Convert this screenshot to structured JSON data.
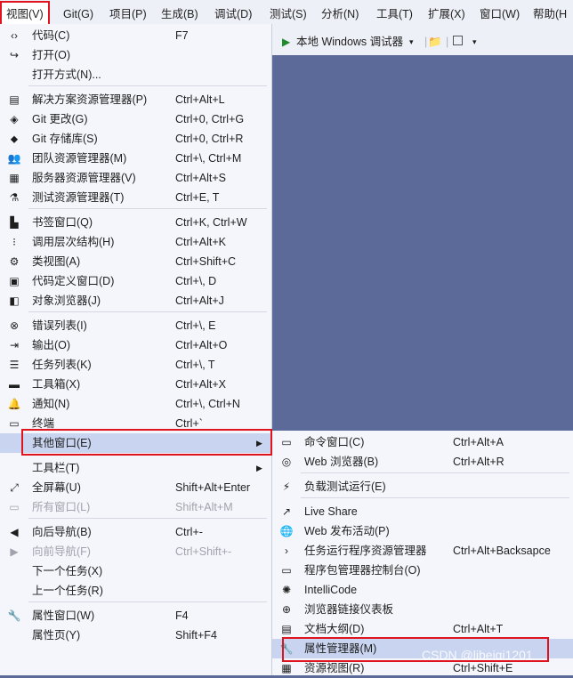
{
  "menubar": [
    {
      "label": "视图(V)",
      "active": true
    },
    {
      "label": "Git(G)"
    },
    {
      "label": "项目(P)"
    },
    {
      "label": "生成(B)"
    },
    {
      "label": "调试(D)"
    },
    {
      "label": "测试(S)"
    },
    {
      "label": "分析(N)"
    },
    {
      "label": "工具(T)"
    },
    {
      "label": "扩展(X)"
    },
    {
      "label": "窗口(W)"
    },
    {
      "label": "帮助(H"
    }
  ],
  "toolbar": {
    "run_label": "本地 Windows 调试器",
    "dropdown": "▾"
  },
  "menu": [
    {
      "label": "代码(C)",
      "shortcut": "F7",
      "icon": "code-icon"
    },
    {
      "label": "打开(O)",
      "shortcut": "",
      "icon": "open-icon"
    },
    {
      "label": "打开方式(N)...",
      "shortcut": "",
      "icon": ""
    },
    {
      "sep": true
    },
    {
      "label": "解决方案资源管理器(P)",
      "shortcut": "Ctrl+Alt+L",
      "icon": "solution-explorer-icon"
    },
    {
      "label": "Git 更改(G)",
      "shortcut": "Ctrl+0, Ctrl+G",
      "icon": "git-changes-icon"
    },
    {
      "label": "Git 存储库(S)",
      "shortcut": "Ctrl+0, Ctrl+R",
      "icon": "git-repository-icon"
    },
    {
      "label": "团队资源管理器(M)",
      "shortcut": "Ctrl+\\, Ctrl+M",
      "icon": "team-explorer-icon"
    },
    {
      "label": "服务器资源管理器(V)",
      "shortcut": "Ctrl+Alt+S",
      "icon": "server-explorer-icon"
    },
    {
      "label": "测试资源管理器(T)",
      "shortcut": "Ctrl+E, T",
      "icon": "test-explorer-icon"
    },
    {
      "sep": true
    },
    {
      "label": "书签窗口(Q)",
      "shortcut": "Ctrl+K, Ctrl+W",
      "icon": "bookmark-icon"
    },
    {
      "label": "调用层次结构(H)",
      "shortcut": "Ctrl+Alt+K",
      "icon": "call-hierarchy-icon"
    },
    {
      "label": "类视图(A)",
      "shortcut": "Ctrl+Shift+C",
      "icon": "class-view-icon"
    },
    {
      "label": "代码定义窗口(D)",
      "shortcut": "Ctrl+\\, D",
      "icon": "code-definition-icon"
    },
    {
      "label": "对象浏览器(J)",
      "shortcut": "Ctrl+Alt+J",
      "icon": "object-browser-icon"
    },
    {
      "sep": true
    },
    {
      "label": "错误列表(I)",
      "shortcut": "Ctrl+\\, E",
      "icon": "error-list-icon"
    },
    {
      "label": "输出(O)",
      "shortcut": "Ctrl+Alt+O",
      "icon": "output-icon"
    },
    {
      "label": "任务列表(K)",
      "shortcut": "Ctrl+\\, T",
      "icon": "task-list-icon"
    },
    {
      "label": "工具箱(X)",
      "shortcut": "Ctrl+Alt+X",
      "icon": "toolbox-icon"
    },
    {
      "label": "通知(N)",
      "shortcut": "Ctrl+\\, Ctrl+N",
      "icon": "notification-bell-icon"
    },
    {
      "label": "终端",
      "shortcut": "Ctrl+`",
      "icon": "terminal-icon"
    },
    {
      "label": "其他窗口(E)",
      "shortcut": "",
      "icon": "",
      "submenu": true,
      "highlight": true
    },
    {
      "sep": true
    },
    {
      "label": "工具栏(T)",
      "shortcut": "",
      "icon": "",
      "submenu": true
    },
    {
      "label": "全屏幕(U)",
      "shortcut": "Shift+Alt+Enter",
      "icon": "fullscreen-icon"
    },
    {
      "label": "所有窗口(L)",
      "shortcut": "Shift+Alt+M",
      "icon": "all-windows-icon",
      "disabled": true
    },
    {
      "sep": true
    },
    {
      "label": "向后导航(B)",
      "shortcut": "Ctrl+-",
      "icon": "navigate-back-icon"
    },
    {
      "label": "向前导航(F)",
      "shortcut": "Ctrl+Shift+-",
      "icon": "navigate-forward-icon",
      "disabled": true
    },
    {
      "label": "下一个任务(X)",
      "shortcut": "",
      "icon": ""
    },
    {
      "label": "上一个任务(R)",
      "shortcut": "",
      "icon": ""
    },
    {
      "sep": true
    },
    {
      "label": "属性窗口(W)",
      "shortcut": "F4",
      "icon": "wrench-icon"
    },
    {
      "label": "属性页(Y)",
      "shortcut": "Shift+F4",
      "icon": ""
    }
  ],
  "submenu": [
    {
      "label": "命令窗口(C)",
      "shortcut": "Ctrl+Alt+A",
      "icon": "command-window-icon"
    },
    {
      "label": "Web 浏览器(B)",
      "shortcut": "Ctrl+Alt+R",
      "icon": "web-browser-icon"
    },
    {
      "sep": true
    },
    {
      "label": "负载测试运行(E)",
      "shortcut": "",
      "icon": "load-test-icon"
    },
    {
      "sep": true
    },
    {
      "label": "Live Share",
      "shortcut": "",
      "icon": "live-share-icon"
    },
    {
      "label": "Web 发布活动(P)",
      "shortcut": "",
      "icon": "web-publish-icon"
    },
    {
      "label": "任务运行程序资源管理器",
      "shortcut": "Ctrl+Alt+Backsapce",
      "icon": "task-runner-icon"
    },
    {
      "label": "程序包管理器控制台(O)",
      "shortcut": "",
      "icon": "package-console-icon"
    },
    {
      "label": "IntelliCode",
      "shortcut": "",
      "icon": "intellicode-icon"
    },
    {
      "label": "浏览器链接仪表板",
      "shortcut": "",
      "icon": "browser-link-icon"
    },
    {
      "label": "文档大纲(D)",
      "shortcut": "Ctrl+Alt+T",
      "icon": "document-outline-icon"
    },
    {
      "label": "属性管理器(M)",
      "shortcut": "",
      "icon": "wrench-icon",
      "highlight": true
    },
    {
      "label": "资源视图(R)",
      "shortcut": "Ctrl+Shift+E",
      "icon": "resource-view-icon"
    }
  ],
  "icons": {
    "code-icon": "‹›",
    "open-icon": "↪",
    "solution-explorer-icon": "▤",
    "git-changes-icon": "◈",
    "git-repository-icon": "⬥",
    "team-explorer-icon": "👥",
    "server-explorer-icon": "▦",
    "test-explorer-icon": "⚗",
    "bookmark-icon": "▙",
    "call-hierarchy-icon": "⁝",
    "class-view-icon": "⚙",
    "code-definition-icon": "▣",
    "object-browser-icon": "◧",
    "error-list-icon": "⊗",
    "output-icon": "⇥",
    "task-list-icon": "☰",
    "toolbox-icon": "▬",
    "notification-bell-icon": "🔔",
    "terminal-icon": "▭",
    "fullscreen-icon": "⤢",
    "all-windows-icon": "▭",
    "navigate-back-icon": "◀",
    "navigate-forward-icon": "▶",
    "wrench-icon": "🔧",
    "command-window-icon": "▭",
    "web-browser-icon": "◎",
    "load-test-icon": "⚡",
    "live-share-icon": "↗",
    "web-publish-icon": "🌐",
    "task-runner-icon": "›",
    "package-console-icon": "▭",
    "intellicode-icon": "✺",
    "browser-link-icon": "⊕",
    "document-outline-icon": "▤",
    "resource-view-icon": "▦"
  },
  "watermark": "CSDN @libeiqi1201"
}
